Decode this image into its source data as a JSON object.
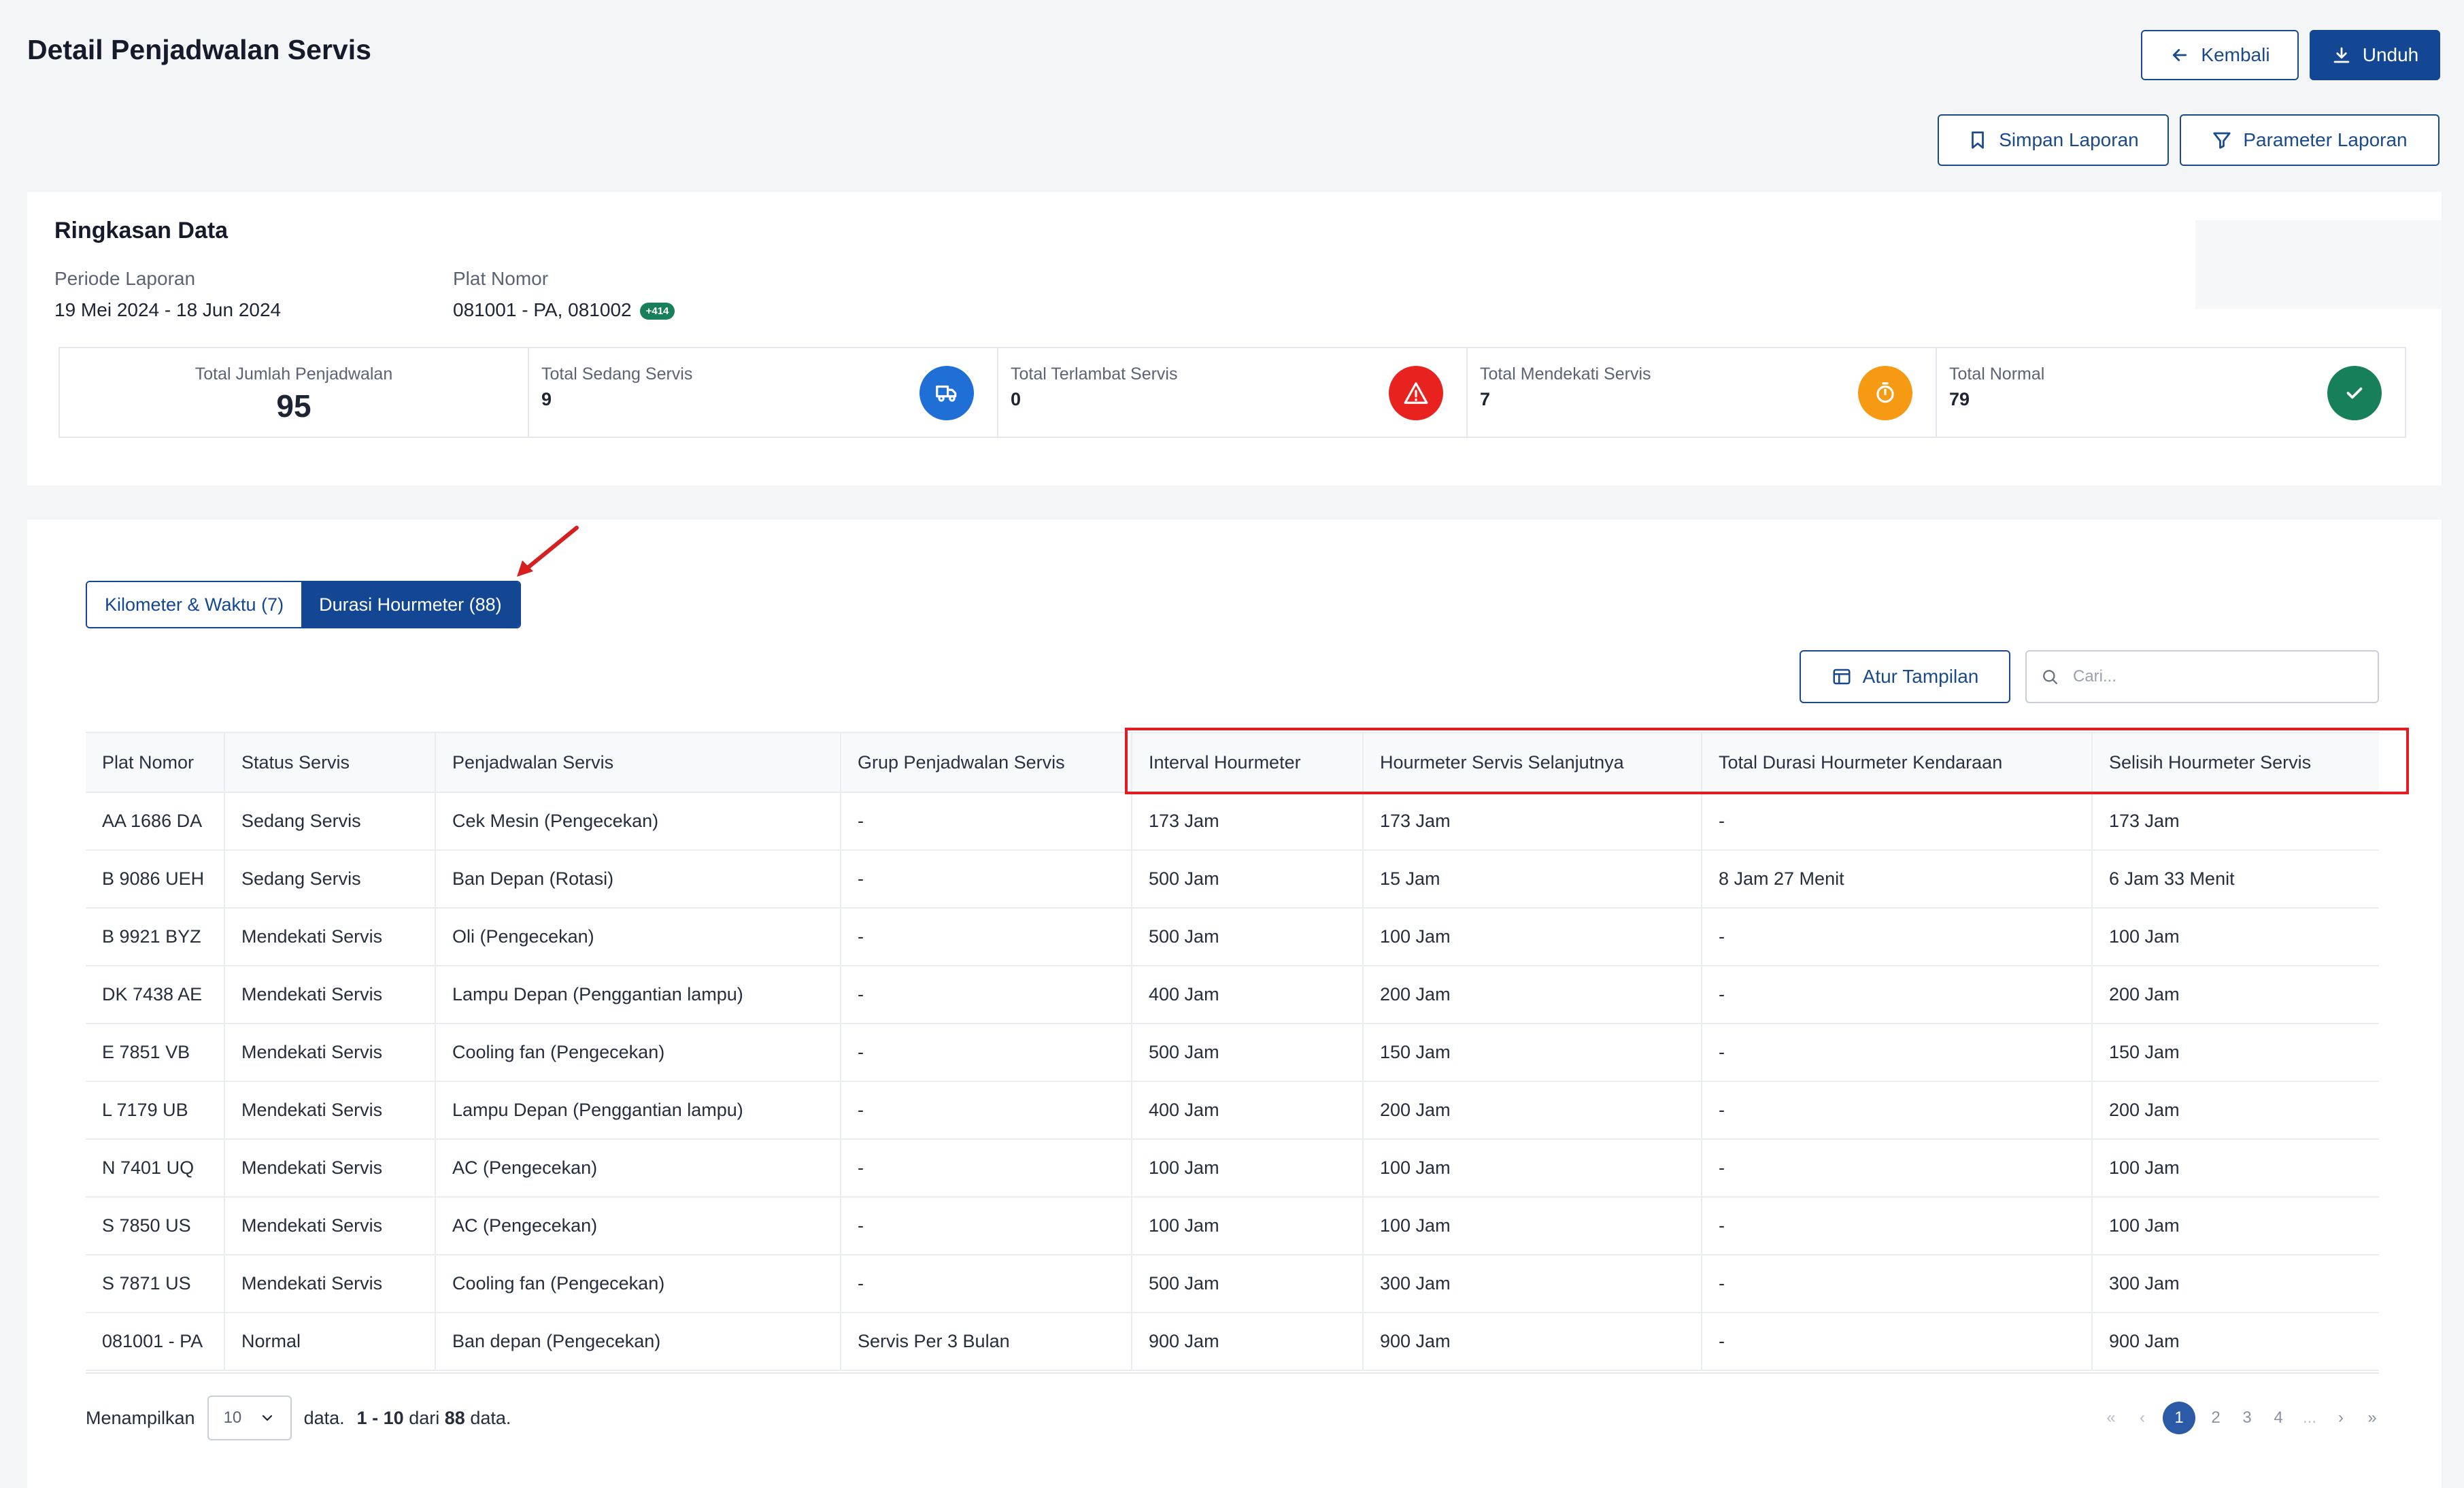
{
  "page": {
    "title": "Detail Penjadwalan Servis"
  },
  "header": {
    "back_label": "Kembali",
    "download_label": "Unduh",
    "save_report_label": "Simpan Laporan",
    "report_params_label": "Parameter Laporan"
  },
  "summary": {
    "title": "Ringkasan Data",
    "period_label": "Periode Laporan",
    "period_value": "19 Mei 2024 - 18 Jun 2024",
    "plate_label": "Plat Nomor",
    "plate_value": "081001 - PA, 081002",
    "plate_more": "+414",
    "stats": {
      "total": {
        "label": "Total Jumlah Penjadwalan",
        "value": "95"
      },
      "in_service": {
        "label": "Total Sedang Servis",
        "value": "9",
        "color": "#1f6fd6",
        "icon": "truck-wrench-icon"
      },
      "late": {
        "label": "Total Terlambat Servis",
        "value": "0",
        "color": "#e8231f",
        "icon": "warning-icon"
      },
      "near": {
        "label": "Total Mendekati Servis",
        "value": "7",
        "color": "#f59a12",
        "icon": "timer-icon"
      },
      "normal": {
        "label": "Total Normal",
        "value": "79",
        "color": "#17805b",
        "icon": "check-icon"
      }
    }
  },
  "tabs": [
    {
      "label": "Kilometer & Waktu (7)"
    },
    {
      "label": "Durasi Hourmeter (88)"
    }
  ],
  "toolbar": {
    "arrange_label": "Atur Tampilan",
    "search_placeholder": "Cari..."
  },
  "table": {
    "columns": [
      "Plat Nomor",
      "Status Servis",
      "Penjadwalan Servis",
      "Grup Penjadwalan Servis",
      "Interval Hourmeter",
      "Hourmeter Servis Selanjutnya",
      "Total Durasi Hourmeter Kendaraan",
      "Selisih Hourmeter Servis"
    ],
    "rows": [
      [
        "AA 1686 DA",
        "Sedang Servis",
        "Cek Mesin (Pengecekan)",
        "-",
        "173 Jam",
        "173 Jam",
        "-",
        "173 Jam"
      ],
      [
        "B 9086 UEH",
        "Sedang Servis",
        "Ban Depan (Rotasi)",
        "-",
        "500 Jam",
        "15 Jam",
        "8 Jam 27 Menit",
        "6 Jam 33 Menit"
      ],
      [
        "B 9921 BYZ",
        "Mendekati Servis",
        "Oli (Pengecekan)",
        "-",
        "500 Jam",
        "100 Jam",
        "-",
        "100 Jam"
      ],
      [
        "DK 7438 AE",
        "Mendekati Servis",
        "Lampu Depan (Penggantian lampu)",
        "-",
        "400 Jam",
        "200 Jam",
        "-",
        "200 Jam"
      ],
      [
        "E 7851 VB",
        "Mendekati Servis",
        "Cooling fan (Pengecekan)",
        "-",
        "500 Jam",
        "150 Jam",
        "-",
        "150 Jam"
      ],
      [
        "L 7179 UB",
        "Mendekati Servis",
        "Lampu Depan (Penggantian lampu)",
        "-",
        "400 Jam",
        "200 Jam",
        "-",
        "200 Jam"
      ],
      [
        "N 7401 UQ",
        "Mendekati Servis",
        "AC (Pengecekan)",
        "-",
        "100 Jam",
        "100 Jam",
        "-",
        "100 Jam"
      ],
      [
        "S 7850 US",
        "Mendekati Servis",
        "AC (Pengecekan)",
        "-",
        "100 Jam",
        "100 Jam",
        "-",
        "100 Jam"
      ],
      [
        "S 7871 US",
        "Mendekati Servis",
        "Cooling fan (Pengecekan)",
        "-",
        "500 Jam",
        "300 Jam",
        "-",
        "300 Jam"
      ],
      [
        "081001 - PA",
        "Normal",
        "Ban depan (Pengecekan)",
        "Servis Per 3 Bulan",
        "900 Jam",
        "900 Jam",
        "-",
        "900 Jam"
      ]
    ]
  },
  "footer": {
    "showing_label": "Menampilkan",
    "page_size": "10",
    "data_label": "data.",
    "range": "1 - 10",
    "of_label": "dari",
    "total": "88",
    "data_suffix": "data.",
    "pages": [
      "1",
      "2",
      "3",
      "4",
      "..."
    ],
    "first": "«",
    "prev": "‹",
    "next": "›",
    "last": "»"
  }
}
